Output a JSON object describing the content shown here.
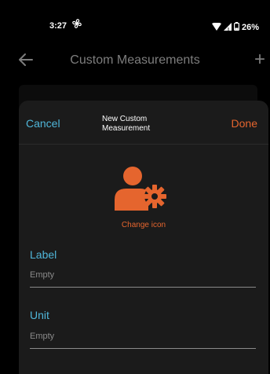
{
  "status": {
    "time": "3:27",
    "battery": "26%"
  },
  "app_bar": {
    "title": "Custom Measurements",
    "back_icon": "arrow-left-icon",
    "add_label": "+"
  },
  "sheet": {
    "cancel_label": "Cancel",
    "title": "New Custom Measurement",
    "done_label": "Done",
    "icon": "user-gear-icon",
    "change_icon_label": "Change icon",
    "fields": [
      {
        "label": "Label",
        "placeholder": "Empty"
      },
      {
        "label": "Unit",
        "placeholder": "Empty"
      }
    ]
  },
  "colors": {
    "accent_blue": "#4fb6d9",
    "accent_orange": "#e5652e",
    "sheet_bg": "#1b1b1b",
    "dim_text": "#7d7d7d"
  }
}
